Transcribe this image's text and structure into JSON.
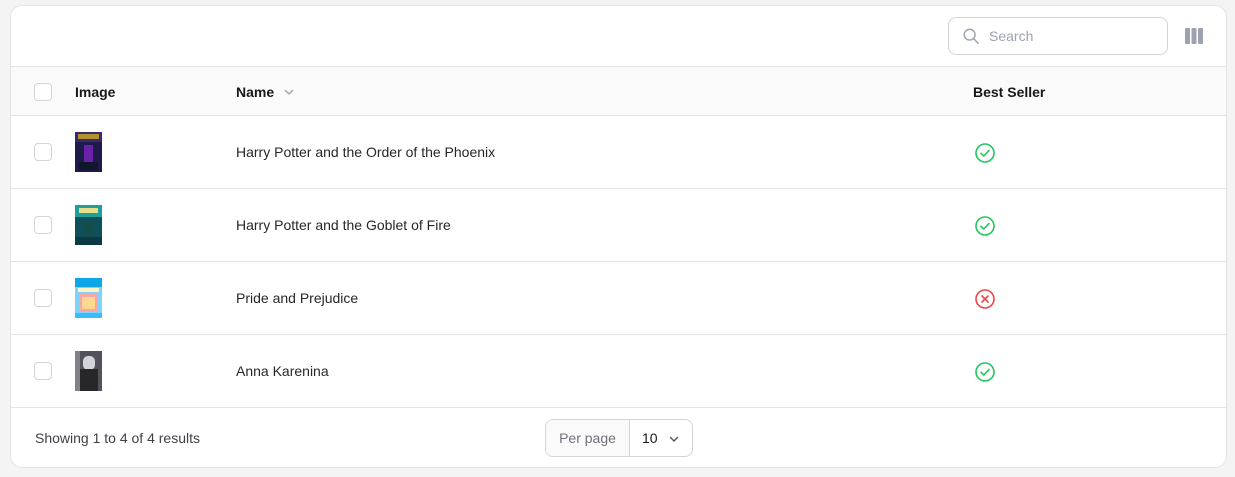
{
  "toolbar": {
    "search_placeholder": "Search",
    "search_icon": "search-icon",
    "columns_icon": "columns-icon"
  },
  "table": {
    "columns": [
      "Image",
      "Name",
      "Best Seller"
    ],
    "sort_icon": "chevron-down-icon",
    "rows": [
      {
        "name": "Harry Potter and the Order of the Phoenix",
        "best_seller": true,
        "status_icon": "check-circle-icon"
      },
      {
        "name": "Harry Potter and the Goblet of Fire",
        "best_seller": true,
        "status_icon": "check-circle-icon"
      },
      {
        "name": "Pride and Prejudice",
        "best_seller": false,
        "status_icon": "x-circle-icon"
      },
      {
        "name": "Anna Karenina",
        "best_seller": true,
        "status_icon": "check-circle-icon"
      }
    ]
  },
  "footer": {
    "results_text": "Showing 1 to 4 of 4 results",
    "per_page_label": "Per page",
    "per_page_value": "10"
  },
  "colors": {
    "success": "#22c55e",
    "danger": "#ef4444",
    "border": "#e4e4e7"
  }
}
